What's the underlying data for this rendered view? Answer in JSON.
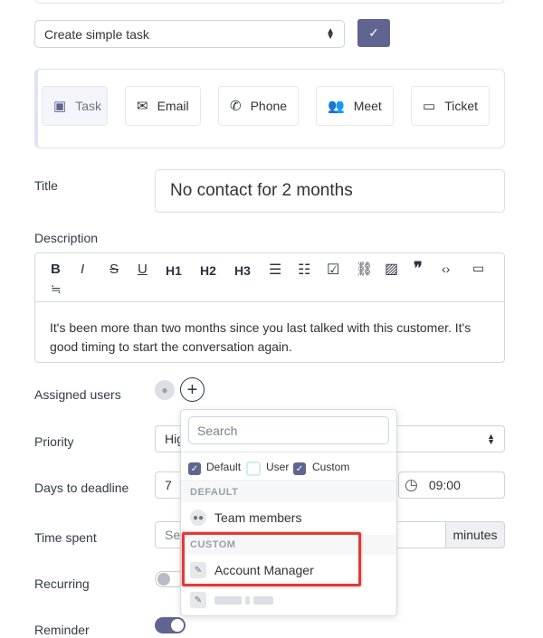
{
  "task_type": {
    "value": "Create simple task"
  },
  "activity_types": [
    {
      "label": "Task",
      "icon": "clipboard-check-icon"
    },
    {
      "label": "Email",
      "icon": "envelope-open-icon"
    },
    {
      "label": "Phone",
      "icon": "phone-icon"
    },
    {
      "label": "Meet",
      "icon": "users-icon"
    },
    {
      "label": "Ticket",
      "icon": "ticket-icon"
    }
  ],
  "title": {
    "label": "Title",
    "value": "No contact for 2 months"
  },
  "description": {
    "label": "Description",
    "toolbar": [
      "B",
      "I",
      "S",
      "U",
      "H1",
      "H2",
      "H3",
      "bullet-list-icon",
      "numbered-list-icon",
      "checklist-icon",
      "link-icon",
      "image-icon",
      "quote-icon",
      "code-icon",
      "code-block-icon",
      "text-wrap-icon"
    ],
    "text": "It's been more than two months since you last talked with this customer. It's good timing to start the conversation again."
  },
  "assigned_users": {
    "label": "Assigned users"
  },
  "priority": {
    "label": "Priority",
    "value_partial": "Hig"
  },
  "days_to_deadline": {
    "label": "Days to deadline",
    "value": "7",
    "time": "09:00"
  },
  "time_spent": {
    "label": "Time spent",
    "placeholder_partial": "Sel",
    "unit": "minutes"
  },
  "recurring": {
    "label": "Recurring",
    "on": false
  },
  "reminder": {
    "label": "Reminder",
    "on": true
  },
  "user_dropdown": {
    "search_placeholder": "Search",
    "filters": [
      {
        "label": "Default",
        "checked": true
      },
      {
        "label": "User",
        "checked": false
      },
      {
        "label": "Custom",
        "checked": true
      }
    ],
    "groups": [
      {
        "header": "DEFAULT",
        "items": [
          "Team members"
        ]
      },
      {
        "header": "CUSTOM",
        "items": [
          "Account Manager"
        ]
      }
    ]
  },
  "colors": {
    "accent": "#5f6590",
    "highlight": "#e53935"
  }
}
